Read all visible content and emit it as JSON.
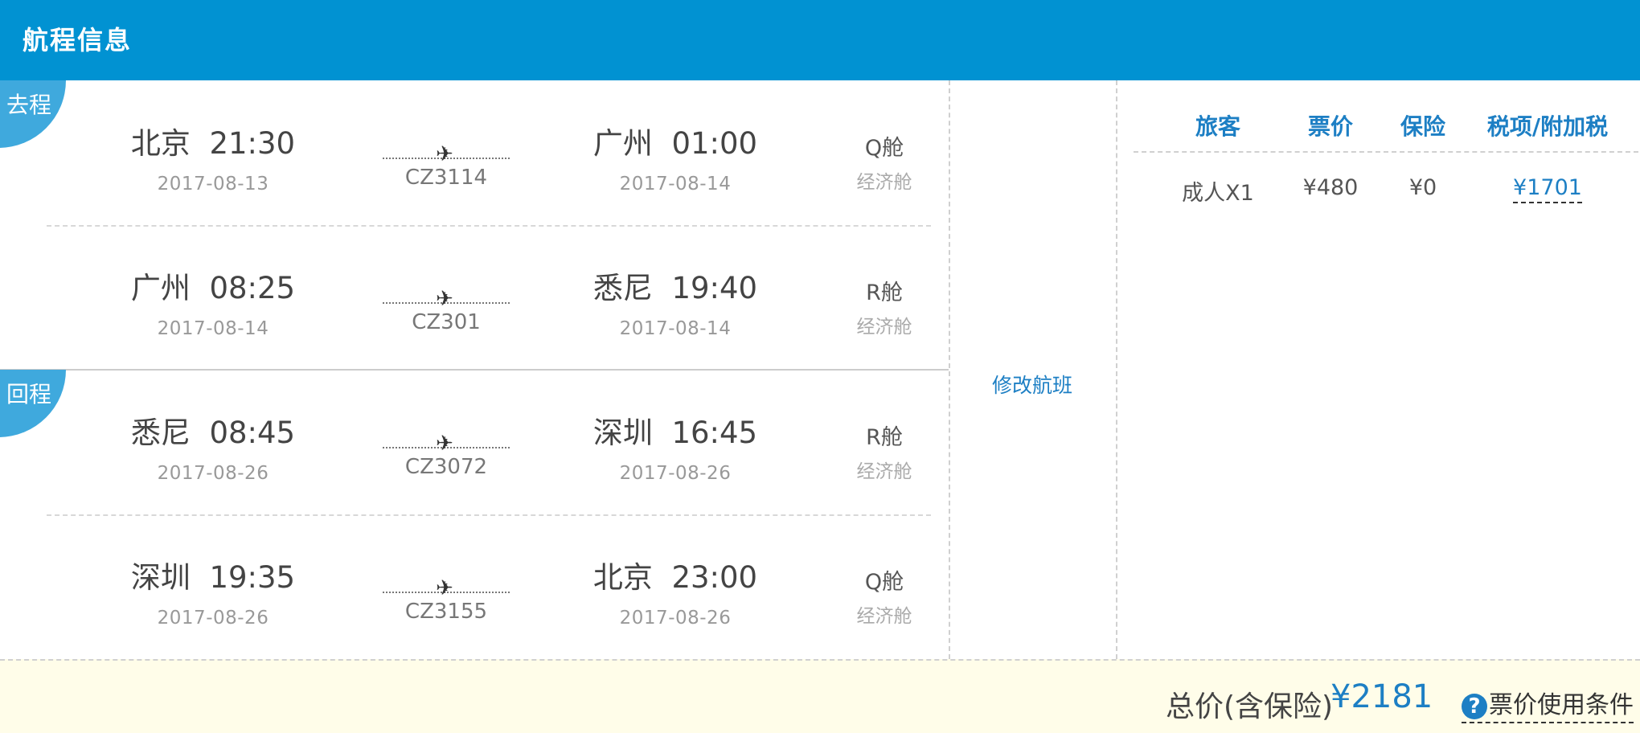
{
  "header": {
    "title": "航程信息"
  },
  "legs": [
    {
      "badge": "去程",
      "dep_city": "北京",
      "dep_time": "21:30",
      "dep_date": "2017-08-13",
      "arr_city": "广州",
      "arr_time": "01:00",
      "arr_date": "2017-08-14",
      "flight_no": "CZ3114",
      "cabin_class": "Q舱",
      "cabin_type": "经济舱"
    },
    {
      "badge": "",
      "dep_city": "广州",
      "dep_time": "08:25",
      "dep_date": "2017-08-14",
      "arr_city": "悉尼",
      "arr_time": "19:40",
      "arr_date": "2017-08-14",
      "flight_no": "CZ301",
      "cabin_class": "R舱",
      "cabin_type": "经济舱"
    },
    {
      "badge": "回程",
      "dep_city": "悉尼",
      "dep_time": "08:45",
      "dep_date": "2017-08-26",
      "arr_city": "深圳",
      "arr_time": "16:45",
      "arr_date": "2017-08-26",
      "flight_no": "CZ3072",
      "cabin_class": "R舱",
      "cabin_type": "经济舱"
    },
    {
      "badge": "",
      "dep_city": "深圳",
      "dep_time": "19:35",
      "dep_date": "2017-08-26",
      "arr_city": "北京",
      "arr_time": "23:00",
      "arr_date": "2017-08-26",
      "flight_no": "CZ3155",
      "cabin_class": "Q舱",
      "cabin_type": "经济舱"
    }
  ],
  "modify_label": "修改航班",
  "price": {
    "headers": [
      "旅客",
      "票价",
      "保险",
      "税项/附加税"
    ],
    "row": {
      "passenger": "成人X1",
      "fare": "¥480",
      "insurance": "¥0",
      "tax": "¥1701"
    }
  },
  "footer": {
    "total_label": "总价(含保险)",
    "total_amount": "¥2181",
    "rules_label": "票价使用条件",
    "help_icon": "help-circle-icon"
  },
  "colors": {
    "header_bg": "#0192d2",
    "accent": "#1d7fc4",
    "badge_bg": "#3fa9dd",
    "footer_bg": "#fffde9"
  }
}
